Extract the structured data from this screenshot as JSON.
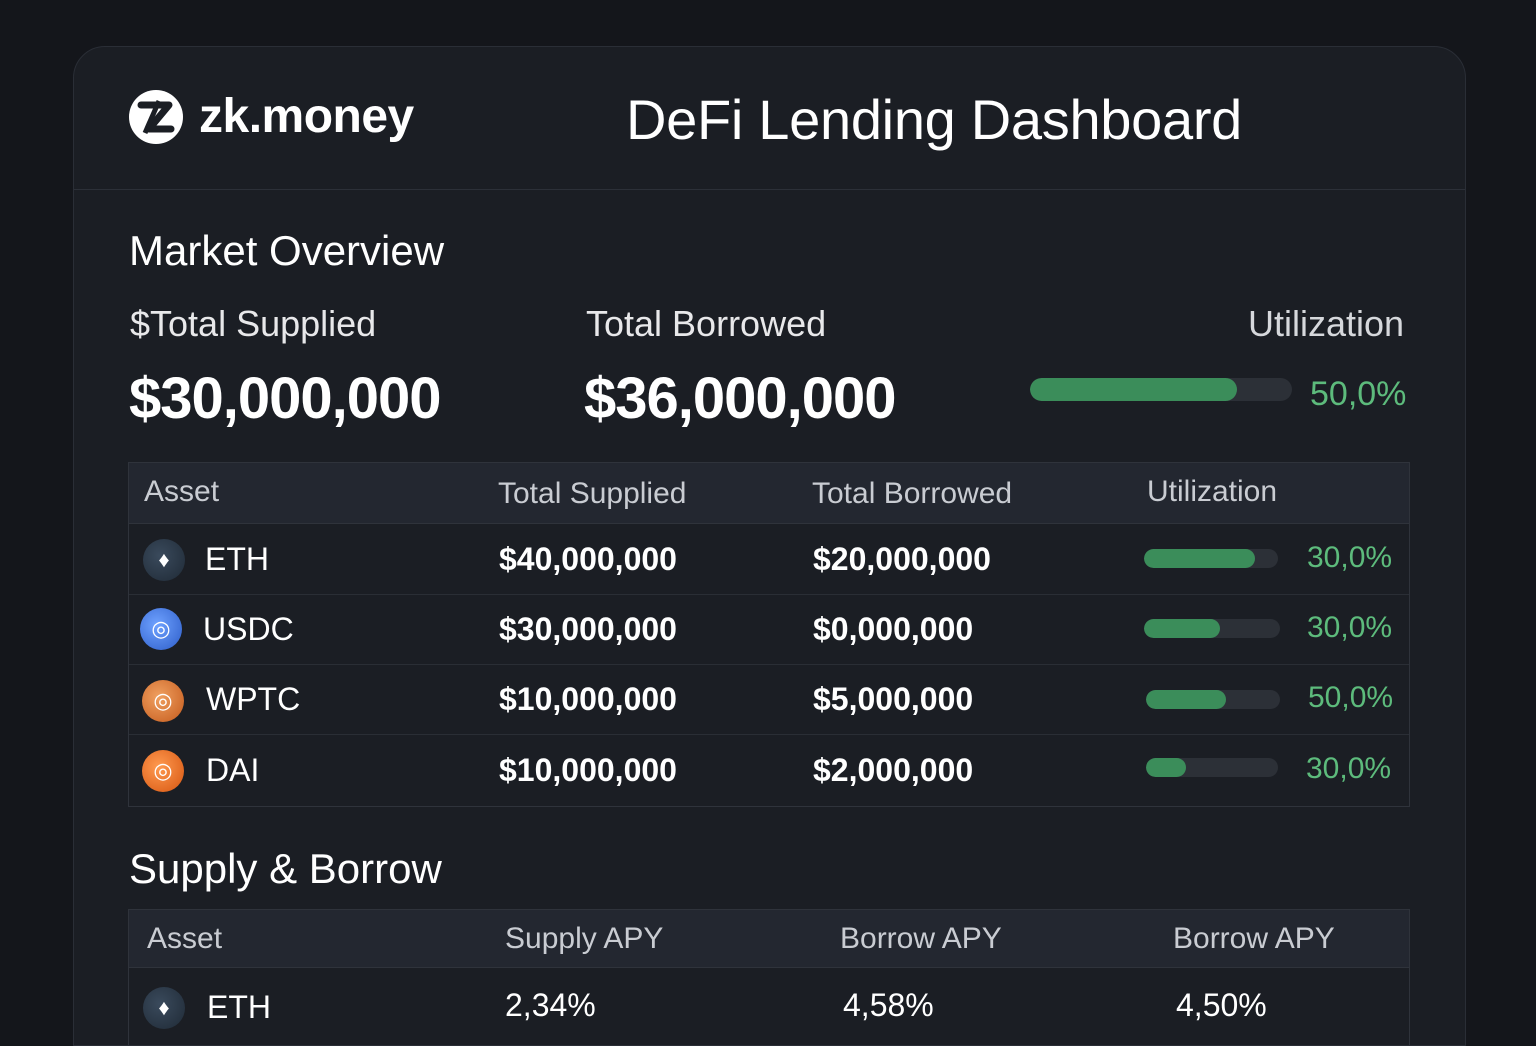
{
  "header": {
    "logo_text": "zk.money",
    "title": "DeFi Lending Dashboard"
  },
  "overview": {
    "title": "Market Overview",
    "total_supplied_label": "$Total Supplied",
    "total_supplied_value": "$30,000,000",
    "total_borrowed_label": "Total Borrowed",
    "total_borrowed_value": "$36,000,000",
    "utilization_label": "Utilization",
    "utilization_value": "50,0%",
    "utilization_fraction": 0.79
  },
  "markets_table": {
    "columns": [
      "Asset",
      "Total Supplied",
      "Total Borrowed",
      "Utilization"
    ],
    "rows": [
      {
        "asset": "ETH",
        "icon": "eth-icon",
        "supplied": "$40,000,000",
        "borrowed": "$20,000,000",
        "utilization": "30,0%",
        "fraction": 0.83
      },
      {
        "asset": "USDC",
        "icon": "usdc-icon",
        "supplied": "$30,000,000",
        "borrowed": "$0,000,000",
        "utilization": "30,0%",
        "fraction": 0.56
      },
      {
        "asset": "WPTC",
        "icon": "wbtc-icon",
        "supplied": "$10,000,000",
        "borrowed": "$5,000,000",
        "utilization": "50,0%",
        "fraction": 0.6
      },
      {
        "asset": "DAI",
        "icon": "dai-icon",
        "supplied": "$10,000,000",
        "borrowed": "$2,000,000",
        "utilization": "30,0%",
        "fraction": 0.3
      }
    ]
  },
  "supply_borrow": {
    "title": "Supply & Borrow",
    "columns": [
      "Asset",
      "Supply APY",
      "Borrow APY",
      "Borrow APY"
    ],
    "rows": [
      {
        "asset": "ETH",
        "icon": "eth-icon",
        "supply_apy": "2,34%",
        "borrow_apy": "4,58%",
        "borrow_apy_2": "4,50%"
      }
    ]
  },
  "colors": {
    "background": "#14161b",
    "card": "#1b1e24",
    "accent_green": "#3b8d5a",
    "accent_green_text": "#5dbb7c"
  }
}
